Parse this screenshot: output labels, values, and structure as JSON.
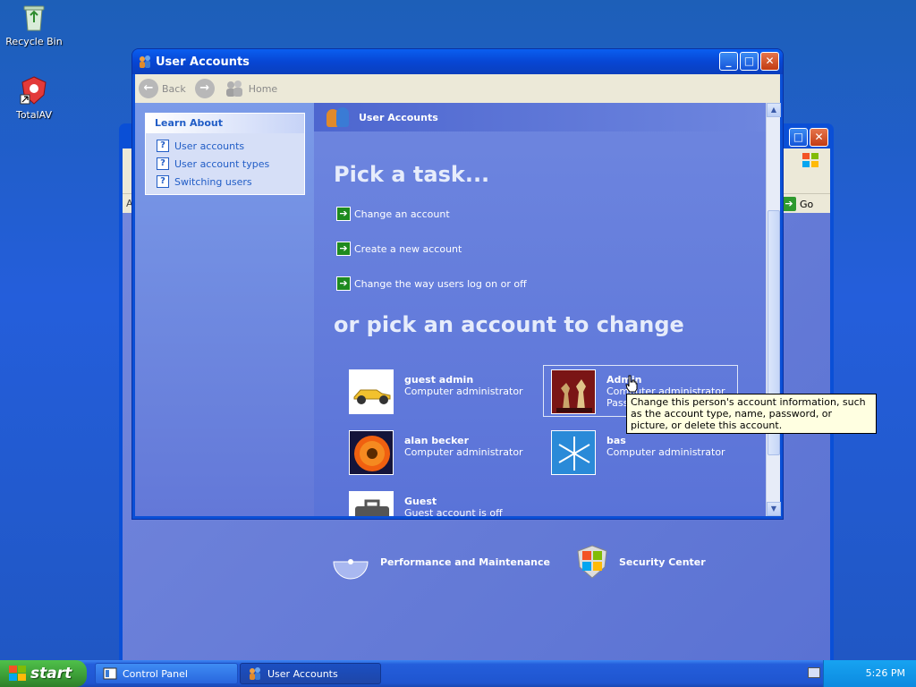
{
  "desktop": {
    "icons": [
      {
        "label": "Recycle Bin"
      },
      {
        "label": "TotalAV"
      }
    ]
  },
  "control_panel": {
    "title": "Control Panel",
    "go_label": "Go",
    "address_prefix": "A",
    "categories": [
      {
        "label": "Performance and Maintenance"
      },
      {
        "label": "Security Center"
      }
    ]
  },
  "window": {
    "title": "User Accounts",
    "toolbar": {
      "back": "Back",
      "home": "Home"
    },
    "learn_about": {
      "heading": "Learn About",
      "items": [
        {
          "label": "User accounts"
        },
        {
          "label": "User account types"
        },
        {
          "label": "Switching users"
        }
      ]
    },
    "header": "User Accounts",
    "pick_task": "Pick a task...",
    "tasks": [
      {
        "label": "Change an account"
      },
      {
        "label": "Create a new account"
      },
      {
        "label": "Change the way users log on or off"
      }
    ],
    "pick_account": "or pick an account to change",
    "accounts": [
      {
        "name": "guest admin",
        "role": "Computer administrator"
      },
      {
        "name": "Admin",
        "role": "Computer administrator",
        "extra": "Pass"
      },
      {
        "name": "alan becker",
        "role": "Computer administrator"
      },
      {
        "name": "bas",
        "role": "Computer administrator"
      },
      {
        "name": "Guest",
        "role": "Guest account is off"
      }
    ],
    "tooltip": "Change this person's account information, such as the account type, name, password, or picture, or delete this account."
  },
  "taskbar": {
    "start": "start",
    "buttons": [
      {
        "label": "Control Panel"
      },
      {
        "label": "User Accounts"
      }
    ],
    "clock": "5:26 PM"
  },
  "colors": {
    "desktop": "#245edb",
    "titlebar": "#0a4fd6",
    "panel": "#6b86e0",
    "start_green": "#3b9c36",
    "tray": "#0c8ae0"
  }
}
